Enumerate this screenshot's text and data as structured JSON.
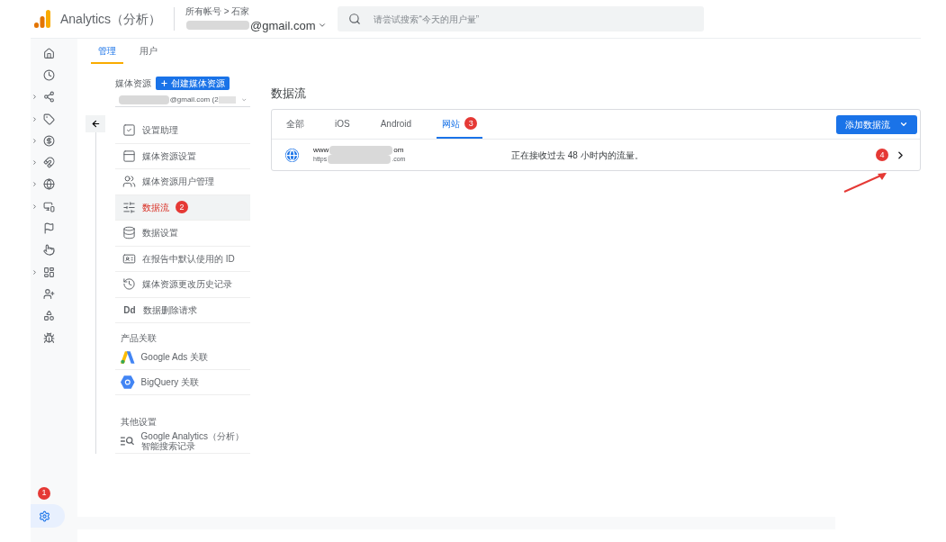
{
  "header": {
    "product": "Analytics（分析）",
    "breadcrumb": "所有帐号 > 石家",
    "account": "@gmail.com",
    "search": {
      "placeholder": "请尝试搜索“今天的用户量”"
    }
  },
  "rail": [
    {
      "kind": "home",
      "expandable": false,
      "selected": false
    },
    {
      "kind": "clock",
      "expandable": false,
      "selected": false
    },
    {
      "kind": "branch",
      "expandable": true,
      "selected": false
    },
    {
      "kind": "tag",
      "expandable": true,
      "selected": false
    },
    {
      "kind": "dollar",
      "expandable": true,
      "selected": false
    },
    {
      "kind": "magnet",
      "expandable": true,
      "selected": false
    },
    {
      "kind": "globe",
      "expandable": true,
      "selected": false
    },
    {
      "kind": "devices",
      "expandable": true,
      "selected": false
    },
    {
      "kind": "flag",
      "expandable": false,
      "selected": false
    },
    {
      "kind": "touch",
      "expandable": false,
      "selected": false
    },
    {
      "kind": "report",
      "expandable": true,
      "selected": false
    },
    {
      "kind": "audience",
      "expandable": false,
      "selected": false
    },
    {
      "kind": "shapes",
      "expandable": false,
      "selected": false
    },
    {
      "kind": "bug",
      "expandable": false,
      "selected": false
    }
  ],
  "settings": {
    "badge": "1",
    "selected": true
  },
  "top_tabs": [
    {
      "label": "管理",
      "selected": true
    },
    {
      "label": "用户",
      "selected": false
    }
  ],
  "property": {
    "label": "媒体资源",
    "create_button": "创建媒体资源",
    "selector": "@gmail.com (2"
  },
  "menu": [
    {
      "kind": "checklist",
      "label": "设置助理",
      "selected": false
    },
    {
      "kind": "layout",
      "label": "媒体资源设置",
      "selected": false
    },
    {
      "kind": "people",
      "label": "媒体资源用户管理",
      "selected": false
    },
    {
      "kind": "streams",
      "label": "数据流",
      "selected": true,
      "badge": "2"
    },
    {
      "kind": "database",
      "label": "数据设置",
      "selected": false
    },
    {
      "kind": "id",
      "label": "在报告中默认使用的 ID",
      "selected": false
    },
    {
      "kind": "history",
      "label": "媒体资源更改历史记录",
      "selected": false
    },
    {
      "kind": "dd",
      "label": "数据删除请求",
      "selected": false,
      "icon_text": "Dd"
    }
  ],
  "sections": [
    {
      "heading": "产品关联",
      "items": [
        {
          "kind": "ads",
          "label": "Google Ads 关联"
        },
        {
          "kind": "bigquery",
          "label": "BigQuery 关联"
        }
      ]
    },
    {
      "heading": "其他设置",
      "items": [
        {
          "kind": "search-history",
          "label": "Google Analytics（分析）智能搜索记录"
        }
      ]
    }
  ],
  "page_title": "数据流",
  "stream_tabs": [
    {
      "label": "全部",
      "selected": false
    },
    {
      "label": "iOS",
      "selected": false
    },
    {
      "label": "Android",
      "selected": false
    },
    {
      "label": "网站",
      "selected": true,
      "badge": "3"
    }
  ],
  "add_button": "添加数据流",
  "streams": [
    {
      "name_start": "www",
      "name_end": "om",
      "url_start": "https",
      "url_end": ".com",
      "status": "正在接收过去 48 小时内的流量。",
      "badge": "4"
    }
  ]
}
